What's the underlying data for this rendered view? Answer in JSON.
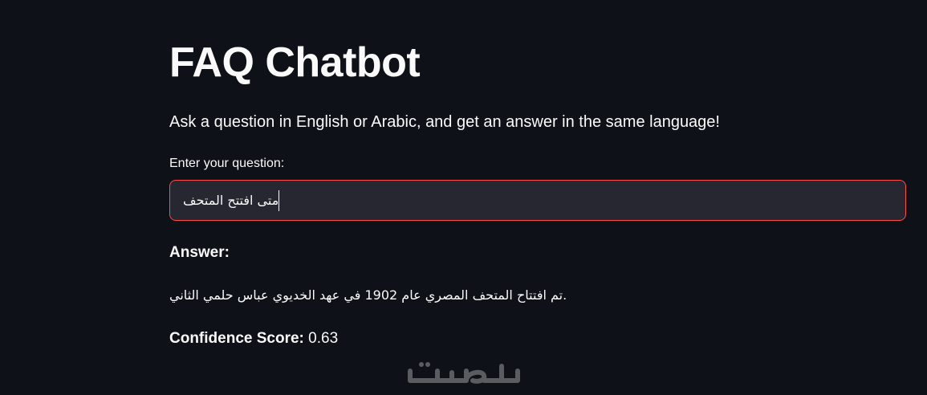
{
  "page": {
    "title": "FAQ Chatbot",
    "subtitle": "Ask a question in English or Arabic, and get an answer in the same language!"
  },
  "question_input": {
    "label": "Enter your question:",
    "value": "متى افتتح المتحف"
  },
  "answer": {
    "heading": "Answer:",
    "text": "تم افتتاح المتحف المصري عام 1902 في عهد الخديوي عباس حلمي الثاني."
  },
  "confidence": {
    "label": "Confidence Score:",
    "value": "0.63"
  },
  "watermark": {
    "text": "خمسات"
  },
  "colors": {
    "background": "#0e1117",
    "text": "#fafafa",
    "input_background": "#262730",
    "focus_border": "#ff4b4b"
  }
}
